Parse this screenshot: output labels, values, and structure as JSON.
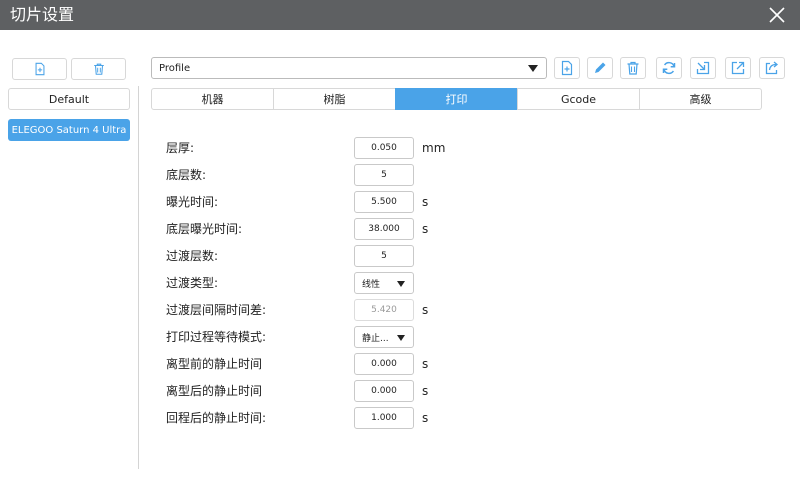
{
  "window": {
    "title": "切片设置"
  },
  "sidebar": {
    "configs": [
      {
        "label": "Default"
      },
      {
        "label": "ELEGOO Saturn 4 Ultra"
      }
    ]
  },
  "profile": {
    "selected": "Profile"
  },
  "tabs": [
    {
      "label": "机器"
    },
    {
      "label": "树脂"
    },
    {
      "label": "打印"
    },
    {
      "label": "Gcode"
    },
    {
      "label": "高级"
    }
  ],
  "active_tab": "打印",
  "settings": [
    {
      "label": "层厚:",
      "value": "0.050",
      "unit": "mm"
    },
    {
      "label": "底层数:",
      "value": "5",
      "unit": ""
    },
    {
      "label": "曝光时间:",
      "value": "5.500",
      "unit": "s"
    },
    {
      "label": "底层曝光时间:",
      "value": "38.000",
      "unit": "s"
    },
    {
      "label": "过渡层数:",
      "value": "5",
      "unit": ""
    },
    {
      "label": "过渡类型:",
      "value": "线性",
      "unit": ""
    },
    {
      "label": "过渡层间隔时间差:",
      "value": "5.420",
      "unit": "s"
    },
    {
      "label": "打印过程等待模式:",
      "value": "静止...",
      "unit": ""
    },
    {
      "label": "离型前的静止时间",
      "value": "0.000",
      "unit": "s"
    },
    {
      "label": "离型后的静止时间",
      "value": "0.000",
      "unit": "s"
    },
    {
      "label": "回程后的静止时间:",
      "value": "1.000",
      "unit": "s"
    }
  ],
  "colors": {
    "accent": "#4aa3e8",
    "titlebar": "#5e6062"
  }
}
